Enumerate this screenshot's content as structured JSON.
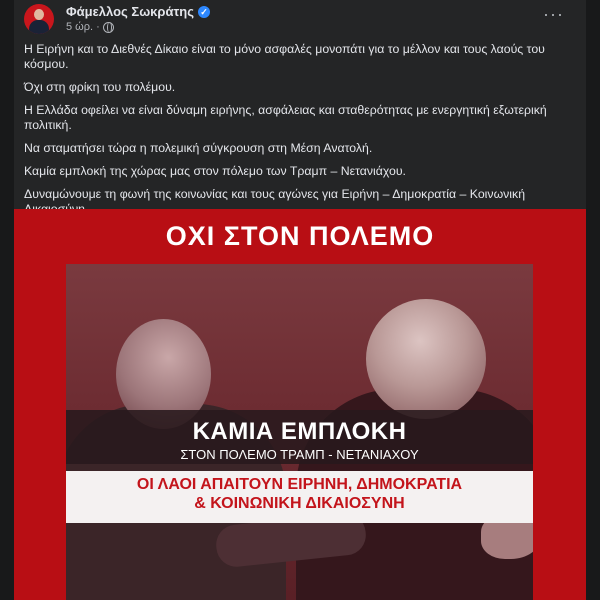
{
  "post": {
    "author": "Φάμελλος Σωκράτης",
    "time": "5 ώρ.",
    "separator": "·",
    "verified_icon": "✓",
    "more_label": "···",
    "paragraphs": [
      "Η Ειρήνη και το Διεθνές Δίκαιο είναι το μόνο ασφαλές μονοπάτι για το μέλλον και τους λαούς του κόσμου.",
      "Όχι στη φρίκη του πολέμου.",
      "Η Ελλάδα οφείλει να είναι δύναμη ειρήνης, ασφάλειας και σταθερότητας με ενεργητική εξωτερική πολιτική.",
      "Να σταματήσει τώρα η πολεμική σύγκρουση στη Μέση Ανατολή.",
      "Καμία εμπλοκή της χώρας μας στον πόλεμο των Τραμπ – Νετανιάχου.",
      "Δυναμώνουμε τη φωνή της κοινωνίας και τους αγώνες για Ειρήνη – Δημοκρατία – Κοινωνική Δικαιοσύνη."
    ]
  },
  "poster": {
    "headline": "ΟΧΙ ΣΤΟΝ ΠΟΛΕΜΟ",
    "band_title": "ΚΑΜΙΑ ΕΜΠΛΟΚΗ",
    "band_subtitle": "ΣΤΟΝ ΠΟΛΕΜΟ ΤΡΑΜΠ - ΝΕΤΑΝΙΑΧΟΥ",
    "red_line1": "ΟΙ ΛΑΟΙ ΑΠΑΙΤΟΥΝ ΕΙΡΗΝΗ, ΔΗΜΟΚΡΑΤΙΑ",
    "red_line2": "& ΚΟΙΝΩΝΙΚΗ ΔΙΚΑΙΟΣΥΝΗ"
  },
  "colors": {
    "background": "#18191a",
    "card": "#242526",
    "text": "#e4e6eb",
    "muted": "#b0b3b8",
    "verified": "#2d88ff",
    "poster_red": "#b80e14"
  }
}
